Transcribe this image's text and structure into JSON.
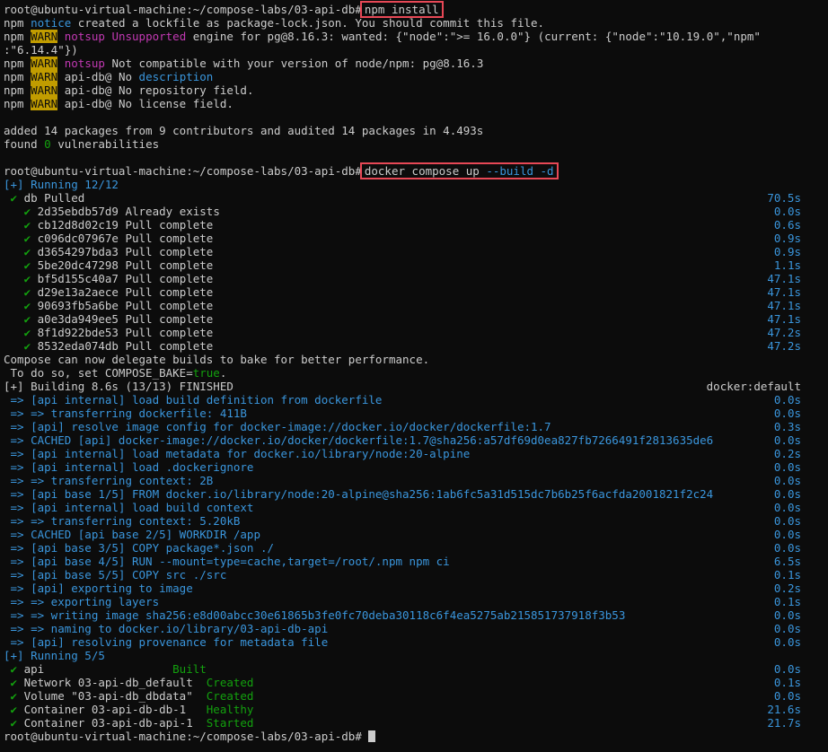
{
  "prompt": "root@ubuntu-virtual-machine:~/compose-labs/03-api-db#",
  "cmd1": "npm install",
  "npm": {
    "l1_a": "npm",
    "l1_b": "notice",
    "l1_c": "created a lockfile as package-lock.json. You should commit this file.",
    "l2_npm": "npm",
    "warn": "WARN",
    "l2_notsup": "notsup",
    "l2_unsupported": "Unsupported",
    "l2_rest": "engine for pg@8.16.3: wanted: {\"node\":\">= 16.0.0\"} (current: {\"node\":\"10.19.0\",\"npm\"",
    "l3": ":\"6.14.4\"})",
    "l4_npm": "npm",
    "l4_notsup": "notsup",
    "l4_rest": "Not compatible with your version of node/npm: pg@8.16.3",
    "l5_npm": "npm",
    "l5_a": "api-db@ No",
    "l5_b": "description",
    "l6_npm": "npm",
    "l6": "api-db@ No repository field.",
    "l7_npm": "npm",
    "l7": "api-db@ No license field.",
    "added": "added 14 packages from 9 contributors and audited 14 packages in 4.493s",
    "found_a": "found",
    "found_n": "0",
    "found_b": "vulnerabilities"
  },
  "cmd2_a": "docker compose up",
  "cmd2_b": "--build -d",
  "running1": "[+] Running 12/12",
  "pull_header": {
    "label": " ✔ db Pulled",
    "time": "70.5s"
  },
  "pulls": [
    {
      "id": "2d35ebdb57d9",
      "status": "Already exists",
      "time": "0.0s"
    },
    {
      "id": "cb12d8d02c19",
      "status": "Pull complete",
      "time": "0.6s"
    },
    {
      "id": "c096dc07967e",
      "status": "Pull complete",
      "time": "0.9s"
    },
    {
      "id": "d3654297bda3",
      "status": "Pull complete",
      "time": "0.9s"
    },
    {
      "id": "5be20dc47298",
      "status": "Pull complete",
      "time": "1.1s"
    },
    {
      "id": "bf5d155c40a7",
      "status": "Pull complete",
      "time": "47.1s"
    },
    {
      "id": "d29e13a2aece",
      "status": "Pull complete",
      "time": "47.1s"
    },
    {
      "id": "90693fb5a6be",
      "status": "Pull complete",
      "time": "47.1s"
    },
    {
      "id": "a0e3da949ee5",
      "status": "Pull complete",
      "time": "47.1s"
    },
    {
      "id": "8f1d922bde53",
      "status": "Pull complete",
      "time": "47.2s"
    },
    {
      "id": "8532eda074db",
      "status": "Pull complete",
      "time": "47.2s"
    }
  ],
  "bake1": "Compose can now delegate builds to bake for better performance.",
  "bake2_a": " To do so, set COMPOSE_BAKE=",
  "bake2_b": "true",
  "bake2_c": ".",
  "building": "[+] Building 8.6s (13/13) FINISHED",
  "builder": "docker:default",
  "build_steps": [
    {
      "text": " => [api internal] load build definition from dockerfile",
      "time": "0.0s"
    },
    {
      "text": " => => transferring dockerfile: 411B",
      "time": "0.0s"
    },
    {
      "text": " => [api] resolve image config for docker-image://docker.io/docker/dockerfile:1.7",
      "time": "0.3s"
    },
    {
      "text": " => CACHED [api] docker-image://docker.io/docker/dockerfile:1.7@sha256:a57df69d0ea827fb7266491f2813635de6",
      "time": "0.0s"
    },
    {
      "text": " => [api internal] load metadata for docker.io/library/node:20-alpine",
      "time": "0.2s"
    },
    {
      "text": " => [api internal] load .dockerignore",
      "time": "0.0s"
    },
    {
      "text": " => => transferring context: 2B",
      "time": "0.0s"
    },
    {
      "text": " => [api base 1/5] FROM docker.io/library/node:20-alpine@sha256:1ab6fc5a31d515dc7b6b25f6acfda2001821f2c24",
      "time": "0.0s"
    },
    {
      "text": " => [api internal] load build context",
      "time": "0.0s"
    },
    {
      "text": " => => transferring context: 5.20kB",
      "time": "0.0s"
    },
    {
      "text": " => CACHED [api base 2/5] WORKDIR /app",
      "time": "0.0s"
    },
    {
      "text": " => [api base 3/5] COPY package*.json ./",
      "time": "0.0s"
    },
    {
      "text": " => [api base 4/5] RUN --mount=type=cache,target=/root/.npm npm ci",
      "time": "6.5s"
    },
    {
      "text": " => [api base 5/5] COPY src ./src",
      "time": "0.1s"
    },
    {
      "text": " => [api] exporting to image",
      "time": "0.2s"
    },
    {
      "text": " => => exporting layers",
      "time": "0.1s"
    },
    {
      "text": " => => writing image sha256:e8d00abcc30e61865b3fe0fc70deba30118c6f4ea5275ab215851737918f3b53",
      "time": "0.0s"
    },
    {
      "text": " => => naming to docker.io/library/03-api-db-api",
      "time": "0.0s"
    },
    {
      "text": " => [api] resolving provenance for metadata file",
      "time": "0.0s"
    }
  ],
  "running2": "[+] Running 5/5",
  "services": [
    {
      "name": " ✔ api                   ",
      "status": "Built",
      "time": "0.0s"
    },
    {
      "name": " ✔ Network 03-api-db_default  ",
      "status": "Created",
      "time": "0.1s"
    },
    {
      "name": " ✔ Volume \"03-api-db_dbdata\"  ",
      "status": "Created",
      "time": "0.0s"
    },
    {
      "name": " ✔ Container 03-api-db-db-1   ",
      "status": "Healthy",
      "time": "21.6s"
    },
    {
      "name": " ✔ Container 03-api-db-api-1  ",
      "status": "Started",
      "time": "21.7s"
    }
  ]
}
